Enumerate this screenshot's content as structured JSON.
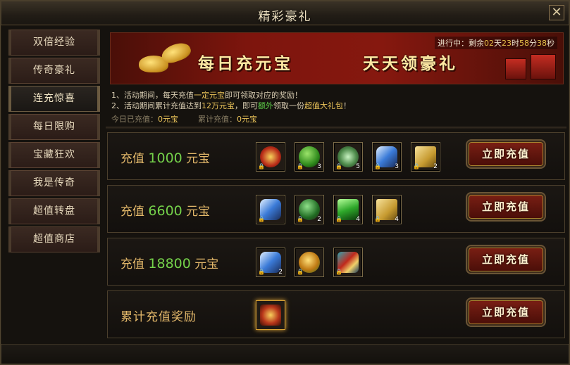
{
  "window": {
    "title": "精彩豪礼",
    "close": "✕"
  },
  "sidebar": {
    "items": [
      {
        "label": "双倍经验"
      },
      {
        "label": "传奇豪礼"
      },
      {
        "label": "连充惊喜"
      },
      {
        "label": "每日限购"
      },
      {
        "label": "宝藏狂欢"
      },
      {
        "label": "我是传奇"
      },
      {
        "label": "超值转盘"
      },
      {
        "label": "超值商店"
      }
    ],
    "active_index": 2
  },
  "banner": {
    "text_left": "每日充元宝",
    "text_right": "天天领豪礼",
    "countdown": {
      "prefix": "进行中：剩余",
      "days": "02",
      "days_unit": "天",
      "hours": "23",
      "hours_unit": "时",
      "minutes": "58",
      "minutes_unit": "分",
      "seconds": "38",
      "seconds_unit": "秒"
    }
  },
  "info": {
    "line1_a": "1、活动期间，每天充值",
    "line1_hl": "一定元宝",
    "line1_b": "即可领取对应的奖励！",
    "line2_a": "2、活动期间累计充值达到",
    "line2_hl1": "12万元宝",
    "line2_b": "，即可",
    "line2_hl2": "额外",
    "line2_c": "领取一份",
    "line2_hl3": "超值大礼包",
    "line2_d": "！",
    "today_label": "今日已充值：",
    "today_value": "0元宝",
    "total_label": "累计充值：",
    "total_value": "0元宝"
  },
  "rows": [
    {
      "prefix": "充值",
      "amount": "1000",
      "suffix": "元宝",
      "items": [
        {
          "icon": "red-gold-orb-icon",
          "qty": ""
        },
        {
          "icon": "green-jade-orb-icon",
          "qty": "3"
        },
        {
          "icon": "green-crystal-ore-icon",
          "qty": "5"
        },
        {
          "icon": "blue-feather-wing-icon",
          "qty": "3"
        },
        {
          "icon": "gold-scroll-icon",
          "qty": "2"
        }
      ],
      "button": "立即充值"
    },
    {
      "prefix": "充值",
      "amount": "6600",
      "suffix": "元宝",
      "items": [
        {
          "icon": "blue-feather-wing-icon",
          "qty": ""
        },
        {
          "icon": "green-pearl-stand-icon",
          "qty": "2"
        },
        {
          "icon": "green-crystal-cluster-icon",
          "qty": "4"
        },
        {
          "icon": "gold-scroll-icon",
          "qty": "4"
        }
      ],
      "button": "立即充值"
    },
    {
      "prefix": "充值",
      "amount": "18800",
      "suffix": "元宝",
      "items": [
        {
          "icon": "blue-feather-wing-icon",
          "qty": "2"
        },
        {
          "icon": "gold-orb-icon",
          "qty": ""
        },
        {
          "icon": "red-treasure-badge-icon",
          "qty": ""
        }
      ],
      "button": "立即充值"
    },
    {
      "label": "累计充值奖励",
      "items": [
        {
          "icon": "golden-lion-chest-icon",
          "qty": ""
        }
      ],
      "button": "立即充值"
    }
  ],
  "colors": {
    "gold_text": "#e3b86a",
    "green_amount": "#74d14a",
    "button_red": "#7a1f14"
  }
}
